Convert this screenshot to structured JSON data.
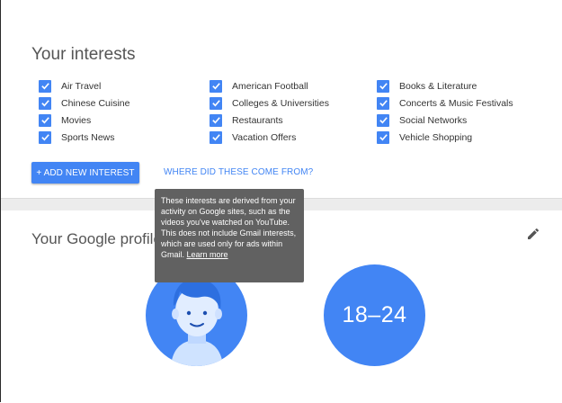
{
  "interests": {
    "title": "Your interests",
    "columns": [
      [
        "Air Travel",
        "Chinese Cuisine",
        "Movies",
        "Sports News"
      ],
      [
        "American Football",
        "Colleges & Universities",
        "Restaurants",
        "Vacation Offers"
      ],
      [
        "Books & Literature",
        "Concerts & Music Festivals",
        "Social Networks",
        "Vehicle Shopping"
      ]
    ],
    "checked": true,
    "add_button_label": "+ ADD NEW INTEREST",
    "where_link_label": "WHERE DID THESE COME FROM?"
  },
  "tooltip": {
    "text": "These interests are derived from your activity on Google sites, such as the videos you've watched on YouTube. This does not include Gmail interests, which are used only for ads within Gmail. ",
    "link_label": "Learn more"
  },
  "profile": {
    "title": "Your Google profile",
    "age_range": "18–24",
    "edit_icon": "pencil-icon",
    "avatar_icon": "person-avatar-icon"
  },
  "colors": {
    "accent": "#4285f4",
    "tooltip_bg": "#616161",
    "divider": "#ececec"
  }
}
